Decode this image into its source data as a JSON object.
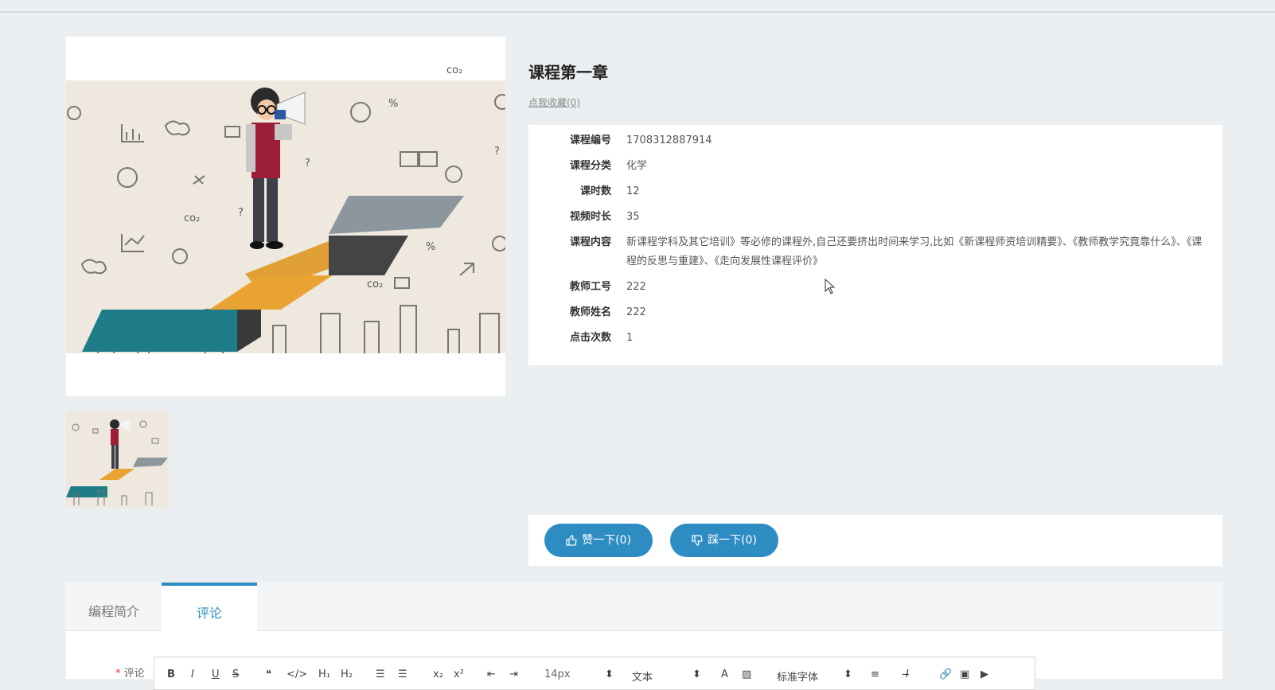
{
  "course": {
    "title": "课程第一章",
    "favorite_link": "点我收藏(0)"
  },
  "info": [
    {
      "label": "课程编号",
      "value": "1708312887914"
    },
    {
      "label": "课程分类",
      "value": "化学"
    },
    {
      "label": "课时数",
      "value": "12"
    },
    {
      "label": "视频时长",
      "value": "35"
    },
    {
      "label": "课程内容",
      "value": "新课程学科及其它培训》等必修的课程外,自己还要挤出时间来学习,比如《新课程师资培训精要》、《教师教学究竟靠什么》、《课程的反思与重建》、《走向发展性课程评价》"
    },
    {
      "label": "教师工号",
      "value": "222"
    },
    {
      "label": "教师姓名",
      "value": "222"
    },
    {
      "label": "点击次数",
      "value": "1"
    }
  ],
  "votes": {
    "like_label": "赞一下(0)",
    "dislike_label": "踩一下(0)"
  },
  "tabs": [
    {
      "label": "编程简介",
      "active": false
    },
    {
      "label": "评论",
      "active": true
    }
  ],
  "comment": {
    "required_mark": "*",
    "label": "评论"
  },
  "editor_toolbar": {
    "bold": "B",
    "italic": "I",
    "underline": "U",
    "strike": "S",
    "blockquote": "❝",
    "code": "</>",
    "h1": "H₁",
    "h2": "H₂",
    "ordered_list": "☰",
    "bullet_list": "☰",
    "subscript": "x₂",
    "superscript": "x²",
    "outdent": "⇤",
    "indent": "⇥",
    "font_size": "14px",
    "paragraph": "文本",
    "font_color": "A",
    "background_color": "▨",
    "font_family": "标准字体",
    "align": "≡",
    "clean": "I̶",
    "link": "🔗",
    "image": "▣",
    "video": "▶"
  },
  "colors": {
    "accent": "#2d8dc3",
    "page_bg": "#eceff1"
  }
}
